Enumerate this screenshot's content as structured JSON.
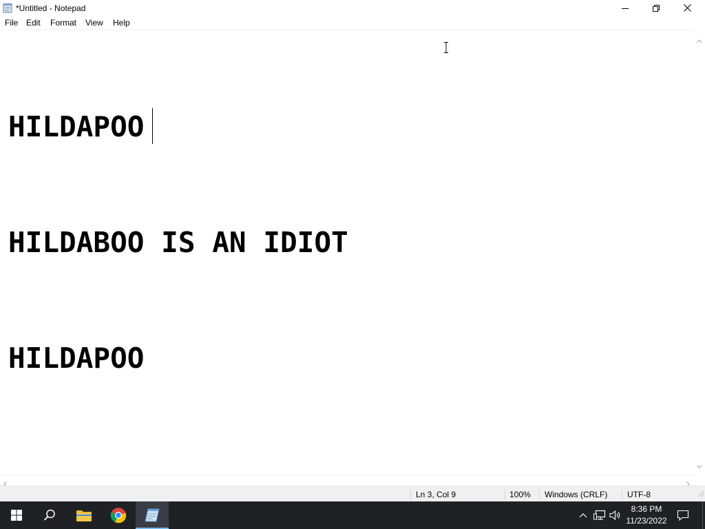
{
  "window": {
    "title": "*Untitled - Notepad",
    "icon": "notepad-icon"
  },
  "menu": {
    "items": [
      "File",
      "Edit",
      "Format",
      "View",
      "Help"
    ]
  },
  "editor": {
    "lines": [
      "HILDAPOO",
      "HILDABOO IS AN IDIOT",
      "HILDAPOO"
    ]
  },
  "statusbar": {
    "position": "Ln 3, Col 9",
    "zoom": "100%",
    "line_ending": "Windows (CRLF)",
    "encoding": "UTF-8"
  },
  "taskbar": {
    "pinned": [
      "start-icon",
      "search-icon",
      "file-explorer-icon",
      "chrome-icon",
      "notepad-icon"
    ],
    "active_app": "notepad",
    "time": "8:36 PM",
    "date": "11/23/2022",
    "accent_color": "#76b9ed",
    "background_color": "#1f2125"
  }
}
